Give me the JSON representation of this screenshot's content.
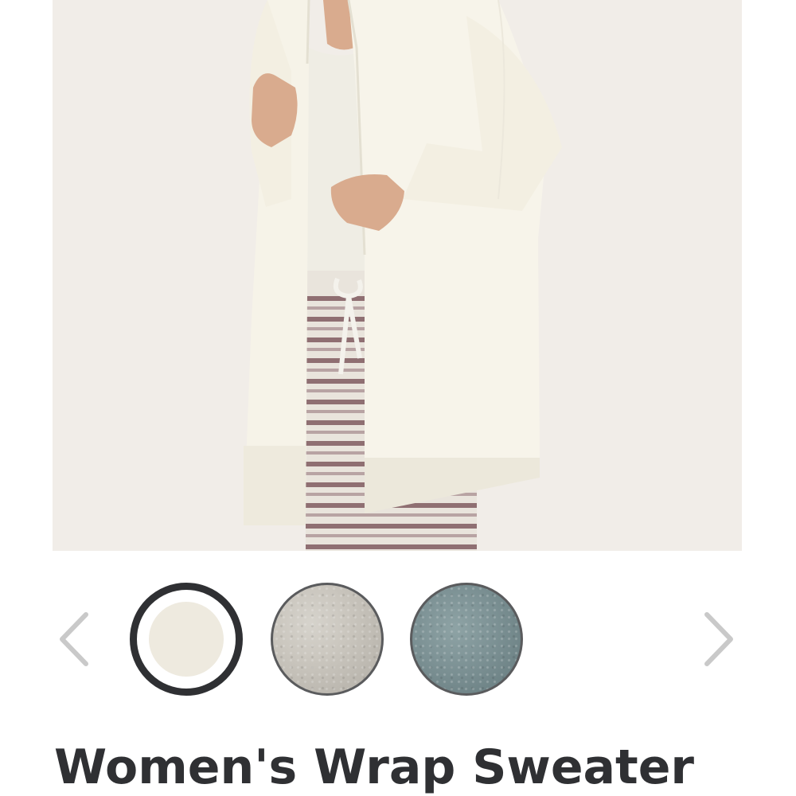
{
  "product": {
    "title": "Women's Wrap Sweater"
  },
  "image": {
    "description_icon": "product-photo"
  },
  "swatches": [
    {
      "name": "cream-swatch",
      "color": "#eeeadf",
      "selected": true
    },
    {
      "name": "heather-grey-swatch",
      "color": "#c6c2ba",
      "selected": false
    },
    {
      "name": "blue-grey-swatch",
      "color": "#7a8f92",
      "selected": false
    }
  ],
  "carousel": {
    "prev_icon": "chevron-left-icon",
    "next_icon": "chevron-right-icon"
  },
  "colors": {
    "title": "#2f3033",
    "arrow": "#c9c9c9",
    "selected_ring": "#2f3033",
    "image_background": "#f1ede8"
  }
}
